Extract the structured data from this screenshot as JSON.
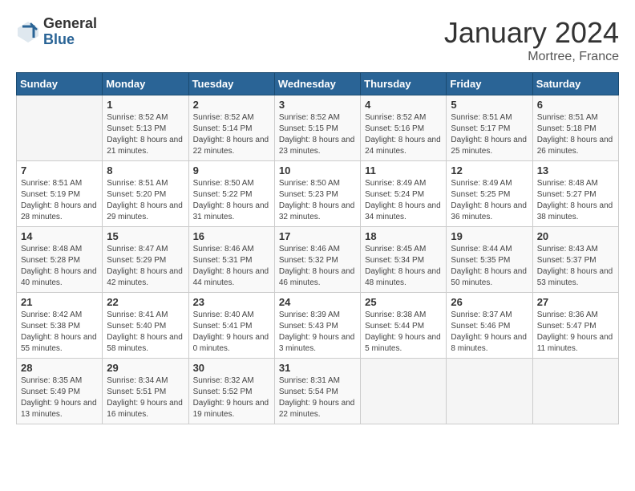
{
  "header": {
    "logo_general": "General",
    "logo_blue": "Blue",
    "title": "January 2024",
    "location": "Mortree, France"
  },
  "days_of_week": [
    "Sunday",
    "Monday",
    "Tuesday",
    "Wednesday",
    "Thursday",
    "Friday",
    "Saturday"
  ],
  "weeks": [
    [
      {
        "day": "",
        "sunrise": "",
        "sunset": "",
        "daylight": ""
      },
      {
        "day": "1",
        "sunrise": "Sunrise: 8:52 AM",
        "sunset": "Sunset: 5:13 PM",
        "daylight": "Daylight: 8 hours and 21 minutes."
      },
      {
        "day": "2",
        "sunrise": "Sunrise: 8:52 AM",
        "sunset": "Sunset: 5:14 PM",
        "daylight": "Daylight: 8 hours and 22 minutes."
      },
      {
        "day": "3",
        "sunrise": "Sunrise: 8:52 AM",
        "sunset": "Sunset: 5:15 PM",
        "daylight": "Daylight: 8 hours and 23 minutes."
      },
      {
        "day": "4",
        "sunrise": "Sunrise: 8:52 AM",
        "sunset": "Sunset: 5:16 PM",
        "daylight": "Daylight: 8 hours and 24 minutes."
      },
      {
        "day": "5",
        "sunrise": "Sunrise: 8:51 AM",
        "sunset": "Sunset: 5:17 PM",
        "daylight": "Daylight: 8 hours and 25 minutes."
      },
      {
        "day": "6",
        "sunrise": "Sunrise: 8:51 AM",
        "sunset": "Sunset: 5:18 PM",
        "daylight": "Daylight: 8 hours and 26 minutes."
      }
    ],
    [
      {
        "day": "7",
        "sunrise": "Sunrise: 8:51 AM",
        "sunset": "Sunset: 5:19 PM",
        "daylight": "Daylight: 8 hours and 28 minutes."
      },
      {
        "day": "8",
        "sunrise": "Sunrise: 8:51 AM",
        "sunset": "Sunset: 5:20 PM",
        "daylight": "Daylight: 8 hours and 29 minutes."
      },
      {
        "day": "9",
        "sunrise": "Sunrise: 8:50 AM",
        "sunset": "Sunset: 5:22 PM",
        "daylight": "Daylight: 8 hours and 31 minutes."
      },
      {
        "day": "10",
        "sunrise": "Sunrise: 8:50 AM",
        "sunset": "Sunset: 5:23 PM",
        "daylight": "Daylight: 8 hours and 32 minutes."
      },
      {
        "day": "11",
        "sunrise": "Sunrise: 8:49 AM",
        "sunset": "Sunset: 5:24 PM",
        "daylight": "Daylight: 8 hours and 34 minutes."
      },
      {
        "day": "12",
        "sunrise": "Sunrise: 8:49 AM",
        "sunset": "Sunset: 5:25 PM",
        "daylight": "Daylight: 8 hours and 36 minutes."
      },
      {
        "day": "13",
        "sunrise": "Sunrise: 8:48 AM",
        "sunset": "Sunset: 5:27 PM",
        "daylight": "Daylight: 8 hours and 38 minutes."
      }
    ],
    [
      {
        "day": "14",
        "sunrise": "Sunrise: 8:48 AM",
        "sunset": "Sunset: 5:28 PM",
        "daylight": "Daylight: 8 hours and 40 minutes."
      },
      {
        "day": "15",
        "sunrise": "Sunrise: 8:47 AM",
        "sunset": "Sunset: 5:29 PM",
        "daylight": "Daylight: 8 hours and 42 minutes."
      },
      {
        "day": "16",
        "sunrise": "Sunrise: 8:46 AM",
        "sunset": "Sunset: 5:31 PM",
        "daylight": "Daylight: 8 hours and 44 minutes."
      },
      {
        "day": "17",
        "sunrise": "Sunrise: 8:46 AM",
        "sunset": "Sunset: 5:32 PM",
        "daylight": "Daylight: 8 hours and 46 minutes."
      },
      {
        "day": "18",
        "sunrise": "Sunrise: 8:45 AM",
        "sunset": "Sunset: 5:34 PM",
        "daylight": "Daylight: 8 hours and 48 minutes."
      },
      {
        "day": "19",
        "sunrise": "Sunrise: 8:44 AM",
        "sunset": "Sunset: 5:35 PM",
        "daylight": "Daylight: 8 hours and 50 minutes."
      },
      {
        "day": "20",
        "sunrise": "Sunrise: 8:43 AM",
        "sunset": "Sunset: 5:37 PM",
        "daylight": "Daylight: 8 hours and 53 minutes."
      }
    ],
    [
      {
        "day": "21",
        "sunrise": "Sunrise: 8:42 AM",
        "sunset": "Sunset: 5:38 PM",
        "daylight": "Daylight: 8 hours and 55 minutes."
      },
      {
        "day": "22",
        "sunrise": "Sunrise: 8:41 AM",
        "sunset": "Sunset: 5:40 PM",
        "daylight": "Daylight: 8 hours and 58 minutes."
      },
      {
        "day": "23",
        "sunrise": "Sunrise: 8:40 AM",
        "sunset": "Sunset: 5:41 PM",
        "daylight": "Daylight: 9 hours and 0 minutes."
      },
      {
        "day": "24",
        "sunrise": "Sunrise: 8:39 AM",
        "sunset": "Sunset: 5:43 PM",
        "daylight": "Daylight: 9 hours and 3 minutes."
      },
      {
        "day": "25",
        "sunrise": "Sunrise: 8:38 AM",
        "sunset": "Sunset: 5:44 PM",
        "daylight": "Daylight: 9 hours and 5 minutes."
      },
      {
        "day": "26",
        "sunrise": "Sunrise: 8:37 AM",
        "sunset": "Sunset: 5:46 PM",
        "daylight": "Daylight: 9 hours and 8 minutes."
      },
      {
        "day": "27",
        "sunrise": "Sunrise: 8:36 AM",
        "sunset": "Sunset: 5:47 PM",
        "daylight": "Daylight: 9 hours and 11 minutes."
      }
    ],
    [
      {
        "day": "28",
        "sunrise": "Sunrise: 8:35 AM",
        "sunset": "Sunset: 5:49 PM",
        "daylight": "Daylight: 9 hours and 13 minutes."
      },
      {
        "day": "29",
        "sunrise": "Sunrise: 8:34 AM",
        "sunset": "Sunset: 5:51 PM",
        "daylight": "Daylight: 9 hours and 16 minutes."
      },
      {
        "day": "30",
        "sunrise": "Sunrise: 8:32 AM",
        "sunset": "Sunset: 5:52 PM",
        "daylight": "Daylight: 9 hours and 19 minutes."
      },
      {
        "day": "31",
        "sunrise": "Sunrise: 8:31 AM",
        "sunset": "Sunset: 5:54 PM",
        "daylight": "Daylight: 9 hours and 22 minutes."
      },
      {
        "day": "",
        "sunrise": "",
        "sunset": "",
        "daylight": ""
      },
      {
        "day": "",
        "sunrise": "",
        "sunset": "",
        "daylight": ""
      },
      {
        "day": "",
        "sunrise": "",
        "sunset": "",
        "daylight": ""
      }
    ]
  ]
}
